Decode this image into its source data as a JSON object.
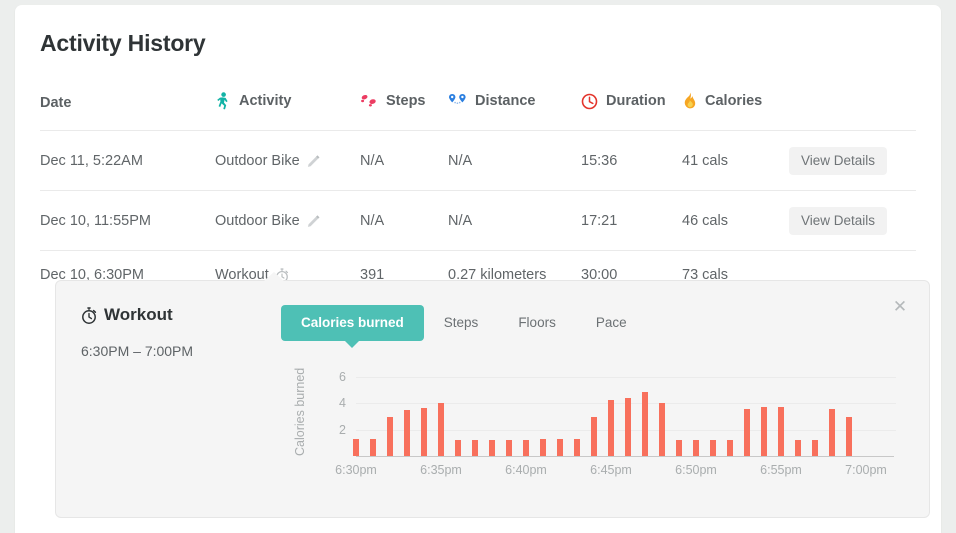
{
  "page": {
    "title": "Activity History"
  },
  "table": {
    "columns": [
      {
        "label": "Date",
        "icon": null
      },
      {
        "label": "Activity",
        "icon": "walking-person-icon"
      },
      {
        "label": "Steps",
        "icon": "footprints-icon"
      },
      {
        "label": "Distance",
        "icon": "map-pins-icon"
      },
      {
        "label": "Duration",
        "icon": "clock-icon"
      },
      {
        "label": "Calories",
        "icon": "flame-icon"
      },
      {
        "label": "",
        "icon": null
      }
    ],
    "rows": [
      {
        "date": "Dec 11, 5:22AM",
        "activity": "Outdoor Bike",
        "activity_icon": "pencil-icon",
        "steps": "N/A",
        "distance": "N/A",
        "duration": "15:36",
        "calories": "41 cals",
        "action": "View Details",
        "has_action": true,
        "selected": false
      },
      {
        "date": "Dec 10, 11:55PM",
        "activity": "Outdoor Bike",
        "activity_icon": "pencil-icon",
        "steps": "N/A",
        "distance": "N/A",
        "duration": "17:21",
        "calories": "46 cals",
        "action": "View Details",
        "has_action": true,
        "selected": false
      },
      {
        "date": "Dec 10, 6:30PM",
        "activity": "Workout",
        "activity_icon": "stopwatch-icon",
        "steps": "391",
        "distance": "0.27 kilometers",
        "duration": "30:00",
        "calories": "73 cals",
        "action": "",
        "has_action": false,
        "selected": true
      }
    ]
  },
  "detail_panel": {
    "title": "Workout",
    "title_icon": "stopwatch-icon",
    "time_range": "6:30PM – 7:00PM",
    "close_label": "✕",
    "tabs": [
      {
        "label": "Calories burned",
        "active": true
      },
      {
        "label": "Steps",
        "active": false
      },
      {
        "label": "Floors",
        "active": false
      },
      {
        "label": "Pace",
        "active": false
      }
    ],
    "accent_color": "#4ec0b5",
    "bar_color": "#f8705c"
  },
  "chart_data": {
    "type": "bar",
    "title": "",
    "xlabel": "",
    "ylabel": "Calories burned",
    "ylim": [
      0,
      7
    ],
    "yticks": [
      2,
      4,
      6
    ],
    "grid": true,
    "legend": null,
    "xticks": [
      "6:30pm",
      "6:35pm",
      "6:40pm",
      "6:45pm",
      "6:50pm",
      "6:55pm",
      "7:00pm"
    ],
    "xtick_minutes": [
      0,
      5,
      10,
      15,
      20,
      25,
      30
    ],
    "x": [
      "6:30pm",
      "6:31pm",
      "6:32pm",
      "6:33pm",
      "6:34pm",
      "6:35pm",
      "6:36pm",
      "6:37pm",
      "6:38pm",
      "6:39pm",
      "6:40pm",
      "6:41pm",
      "6:42pm",
      "6:43pm",
      "6:44pm",
      "6:45pm",
      "6:46pm",
      "6:47pm",
      "6:48pm",
      "6:49pm",
      "6:50pm",
      "6:51pm",
      "6:52pm",
      "6:53pm",
      "6:54pm",
      "6:55pm",
      "6:56pm",
      "6:57pm",
      "6:58pm",
      "6:59pm",
      "7:00pm"
    ],
    "values": [
      1.3,
      1.3,
      3.0,
      3.5,
      3.65,
      4.05,
      1.25,
      1.25,
      1.25,
      1.25,
      1.25,
      1.3,
      1.3,
      1.3,
      3.0,
      4.25,
      4.45,
      4.85,
      4.05,
      1.25,
      1.25,
      1.25,
      1.25,
      3.55,
      3.7,
      3.7,
      1.25,
      1.25,
      3.6,
      3.0,
      0
    ],
    "unit": "calories"
  }
}
